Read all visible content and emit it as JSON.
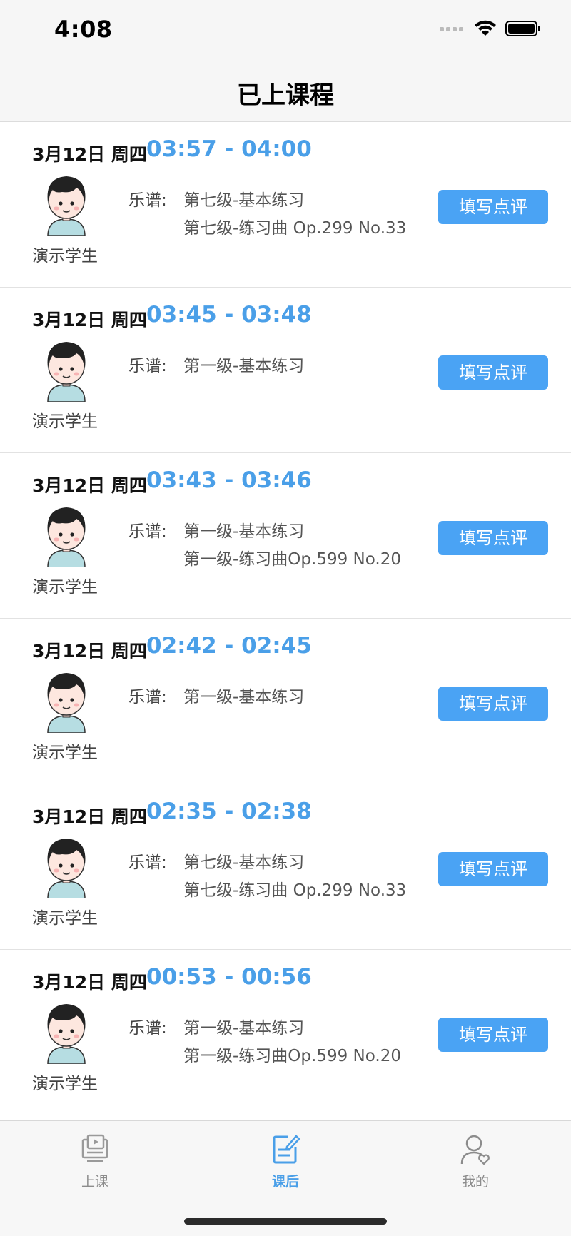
{
  "status": {
    "time": "4:08"
  },
  "nav": {
    "title": "已上课程"
  },
  "colors": {
    "accent": "#4aa3f4",
    "time_range": "#4a9fe8"
  },
  "lessons": [
    {
      "date": "3月12日 周四",
      "time_range": "03:57 - 04:00",
      "student": "演示学生",
      "score_label": "乐谱:",
      "scores": [
        "第七级-基本练习",
        "第七级-练习曲 Op.299 No.33"
      ],
      "action": "填写点评"
    },
    {
      "date": "3月12日 周四",
      "time_range": "03:45 - 03:48",
      "student": "演示学生",
      "score_label": "乐谱:",
      "scores": [
        "第一级-基本练习",
        ""
      ],
      "action": "填写点评"
    },
    {
      "date": "3月12日 周四",
      "time_range": "03:43 - 03:46",
      "student": "演示学生",
      "score_label": "乐谱:",
      "scores": [
        "第一级-基本练习",
        "第一级-练习曲Op.599 No.20"
      ],
      "action": "填写点评"
    },
    {
      "date": "3月12日 周四",
      "time_range": "02:42 - 02:45",
      "student": "演示学生",
      "score_label": "乐谱:",
      "scores": [
        "第一级-基本练习",
        ""
      ],
      "action": "填写点评"
    },
    {
      "date": "3月12日 周四",
      "time_range": "02:35 - 02:38",
      "student": "演示学生",
      "score_label": "乐谱:",
      "scores": [
        "第七级-基本练习",
        "第七级-练习曲 Op.299 No.33"
      ],
      "action": "填写点评"
    },
    {
      "date": "3月12日 周四",
      "time_range": "00:53 - 00:56",
      "student": "演示学生",
      "score_label": "乐谱:",
      "scores": [
        "第一级-基本练习",
        "第一级-练习曲Op.599 No.20"
      ],
      "action": "填写点评"
    }
  ],
  "tabs": [
    {
      "label": "上课",
      "icon": "lesson-video-icon",
      "active": false
    },
    {
      "label": "课后",
      "icon": "notes-edit-icon",
      "active": true
    },
    {
      "label": "我的",
      "icon": "profile-icon",
      "active": false
    }
  ]
}
